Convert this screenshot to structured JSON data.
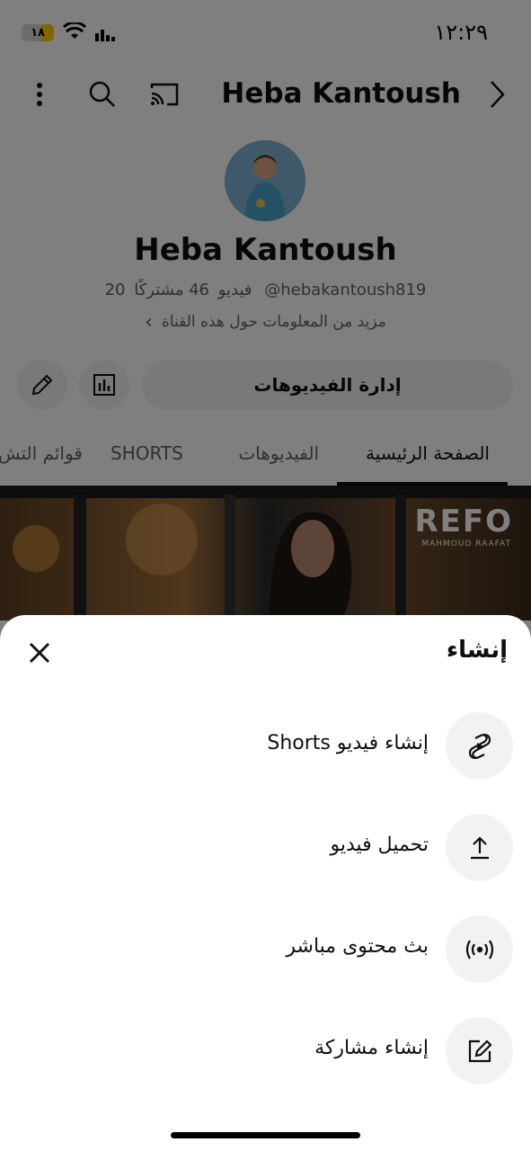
{
  "status_bar": {
    "time": "١٢:٢٩",
    "battery": "١٨"
  },
  "header": {
    "channel_title": "Heba Kantoush"
  },
  "profile": {
    "name": "Heba Kantoush",
    "handle": "@hebakantoush819",
    "subscribers": "46 مشتركًا",
    "videos": "20 فيديو",
    "more_info": "مزيد من المعلومات حول هذه القناة"
  },
  "actions": {
    "manage_videos": "إدارة الفيديوهات"
  },
  "tabs": [
    {
      "label": "الصفحة الرئيسية",
      "active": true
    },
    {
      "label": "الفيديوهات",
      "active": false
    },
    {
      "label": "SHORTS",
      "active": false
    },
    {
      "label": "قوائم التش",
      "active": false
    }
  ],
  "banner": {
    "brand": "REFO",
    "sub": "MAHMOUD RAAFAT"
  },
  "sheet": {
    "title": "إنشاء",
    "items": [
      {
        "label": "إنشاء فيديو  Shorts",
        "icon": "shorts-icon"
      },
      {
        "label": "تحميل فيديو",
        "icon": "upload-icon"
      },
      {
        "label": "بث محتوى مباشر",
        "icon": "live-icon"
      },
      {
        "label": "إنشاء مشاركة",
        "icon": "post-edit-icon"
      }
    ]
  },
  "colors": {
    "accent": "#0f0f0f",
    "battery": "#ffcc00",
    "chip_bg": "#f2f2f2"
  }
}
